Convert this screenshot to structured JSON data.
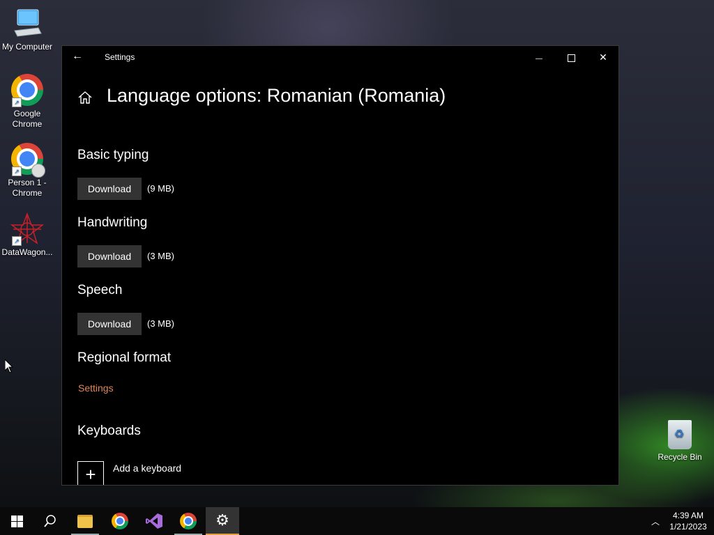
{
  "desktop": {
    "icons": [
      {
        "label": "My Computer",
        "icon": "computer-icon"
      },
      {
        "label": "Google Chrome",
        "icon": "chrome-icon"
      },
      {
        "label": "Person 1 - Chrome",
        "icon": "chrome-profile-icon"
      },
      {
        "label": "DataWagon...",
        "icon": "datawagon-icon"
      }
    ],
    "recycle_bin": {
      "label": "Recycle Bin",
      "icon": "recycle-bin-icon"
    }
  },
  "window": {
    "title": "Settings",
    "back_glyph": "←",
    "min_glyph": "—",
    "close_glyph": "✕"
  },
  "page": {
    "title": "Language options: Romanian (Romania)",
    "sections": {
      "basic_typing": {
        "title": "Basic typing",
        "button": "Download",
        "size": "(9 MB)"
      },
      "handwriting": {
        "title": "Handwriting",
        "button": "Download",
        "size": "(3 MB)"
      },
      "speech": {
        "title": "Speech",
        "button": "Download",
        "size": "(3 MB)"
      },
      "regional_format": {
        "title": "Regional format",
        "link": "Settings"
      },
      "keyboards": {
        "title": "Keyboards",
        "add_label": "Add a keyboard",
        "plus_glyph": "+"
      }
    },
    "link_color": "#e0865a"
  },
  "taskbar": {
    "items": [
      "start-icon",
      "search-icon",
      "file-explorer-icon",
      "chrome-icon",
      "visual-studio-icon",
      "chrome-icon",
      "settings-icon"
    ],
    "tray_chevron": "^",
    "time": "4:39 AM",
    "date": "1/21/2023",
    "active_accent": "#e0a040"
  }
}
